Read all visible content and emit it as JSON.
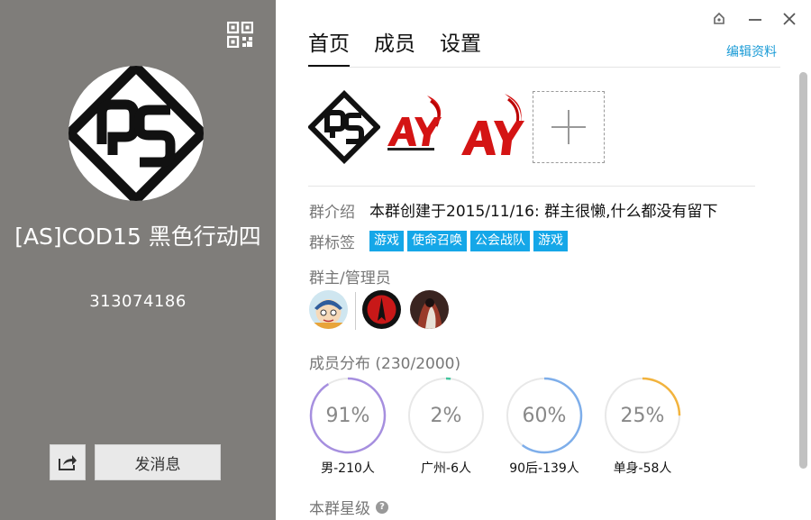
{
  "profile": {
    "name": "[AS]COD15 黑色行动四",
    "group_id": "313074186",
    "send_message_label": "发消息"
  },
  "tabs": [
    {
      "label": "首页",
      "active": true
    },
    {
      "label": "成员",
      "active": false
    },
    {
      "label": "设置",
      "active": false
    }
  ],
  "edit_profile_label": "编辑资料",
  "intro": {
    "label": "群介绍",
    "text": "本群创建于2015/11/16:  群主很懒,什么都没有留下"
  },
  "tags_section": {
    "label": "群标签",
    "tags": [
      "游戏",
      "使命召唤",
      "公会战队",
      "游戏"
    ]
  },
  "admins_section": {
    "label": "群主/管理员"
  },
  "distribution": {
    "label": "成员分布",
    "count": "(230/2000)",
    "stats": [
      {
        "percent": "91%",
        "caption": "男-210人",
        "fraction": 0.91,
        "color": "#a68fdf"
      },
      {
        "percent": "2%",
        "caption": "广州-6人",
        "fraction": 0.02,
        "color": "#43c59e"
      },
      {
        "percent": "60%",
        "caption": "90后-139人",
        "fraction": 0.6,
        "color": "#7eaeea"
      },
      {
        "percent": "25%",
        "caption": "单身-58人",
        "fraction": 0.25,
        "color": "#f2b33d"
      }
    ]
  },
  "star_level": {
    "label": "本群星级",
    "help_icon": "?"
  },
  "colors": {
    "left_panel": "#7f7d7a",
    "link": "#1a9bd6",
    "tag": "#15a7e8",
    "logo_red": "#d41414"
  }
}
